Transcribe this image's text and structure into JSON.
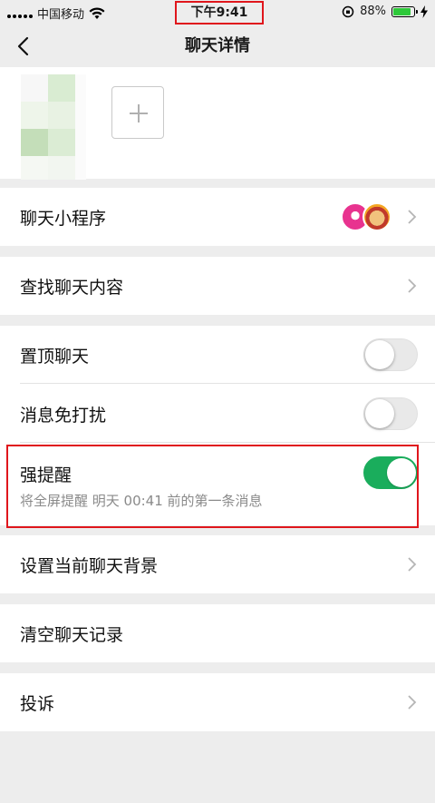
{
  "status_bar": {
    "carrier": "中国移动",
    "time": "下午9:41",
    "battery": "88%",
    "battery_level": 0.88
  },
  "nav": {
    "title": "聊天详情",
    "back_icon": "chevron-left-icon"
  },
  "members": {
    "add_icon": "plus-icon"
  },
  "settings": {
    "mini_programs_label": "聊天小程序",
    "search_label": "查找聊天内容",
    "pin_label": "置顶聊天",
    "pin_on": false,
    "mute_label": "消息免打扰",
    "mute_on": false,
    "strong_remind_label": "强提醒",
    "strong_remind_on": true,
    "strong_remind_desc": "将全屏提醒 明天 00:41 前的第一条消息",
    "background_label": "设置当前聊天背景",
    "clear_label": "清空聊天记录",
    "report_label": "投诉"
  },
  "colors": {
    "accent_green": "#1aad5c",
    "highlight_red": "#e0161c"
  }
}
